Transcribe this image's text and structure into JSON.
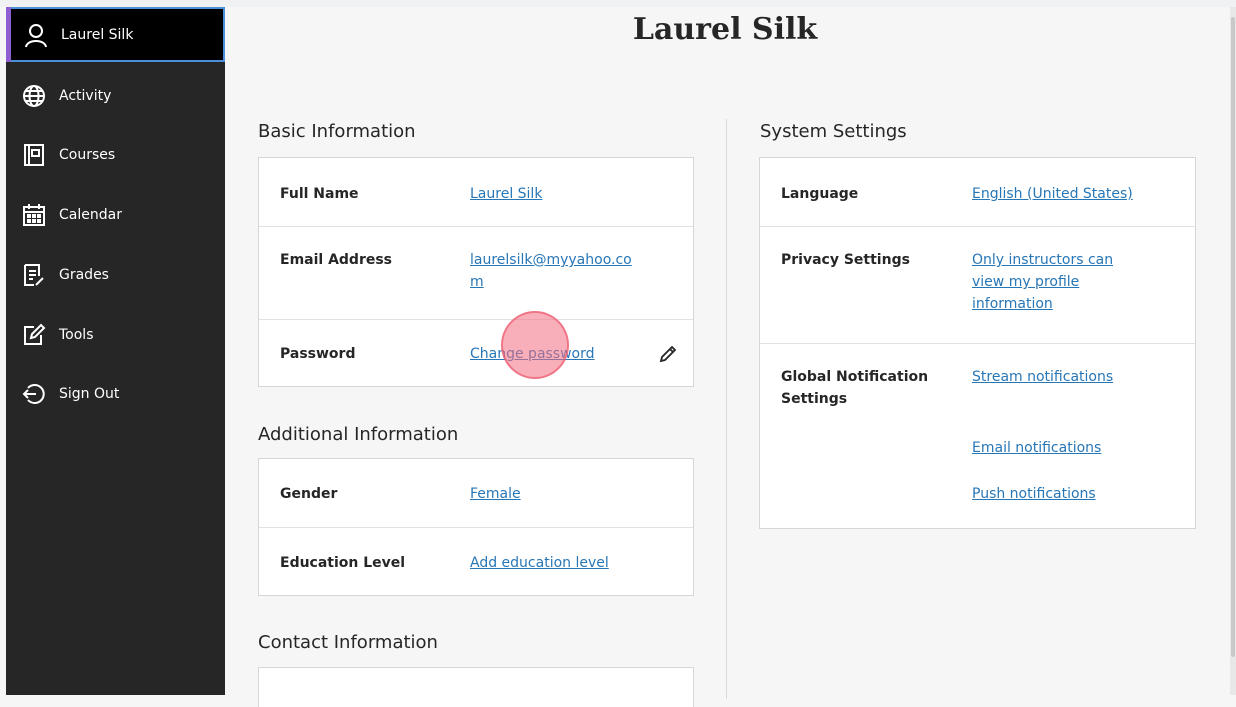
{
  "page": {
    "title": "Laurel Silk"
  },
  "sidebar": {
    "items": [
      {
        "label": "Laurel Silk",
        "icon": "user-icon"
      },
      {
        "label": "Activity",
        "icon": "globe-icon"
      },
      {
        "label": "Courses",
        "icon": "book-icon"
      },
      {
        "label": "Calendar",
        "icon": "calendar-icon"
      },
      {
        "label": "Grades",
        "icon": "grades-icon"
      },
      {
        "label": "Tools",
        "icon": "edit-icon"
      },
      {
        "label": "Sign Out",
        "icon": "sign-out-icon"
      }
    ]
  },
  "basic_info": {
    "title": "Basic Information",
    "full_name_label": "Full Name",
    "full_name_value": "Laurel Silk",
    "email_label": "Email Address",
    "email_value_line1": "laurelsilk@myyahoo.co",
    "email_value_line2": "m",
    "password_label": "Password",
    "password_value": "Change password"
  },
  "additional_info": {
    "title": "Additional Information",
    "gender_label": "Gender",
    "gender_value": "Female",
    "education_label": "Education Level",
    "education_value": "Add education level"
  },
  "contact_info": {
    "title": "Contact Information"
  },
  "system_settings": {
    "title": "System Settings",
    "language_label": "Language",
    "language_value": "English (United States)",
    "privacy_label": "Privacy Settings",
    "privacy_line1": "Only instructors can",
    "privacy_line2": "view my profile",
    "privacy_line3": "information",
    "notif_label_line1": "Global Notification",
    "notif_label_line2": "Settings",
    "stream": "Stream notifications",
    "email": "Email notifications",
    "push": "Push notifications"
  },
  "colors": {
    "sidebar_bg": "#262626",
    "link": "#2776b6",
    "active_border": "#4a8fd9",
    "active_accent": "#8e5fd0"
  }
}
